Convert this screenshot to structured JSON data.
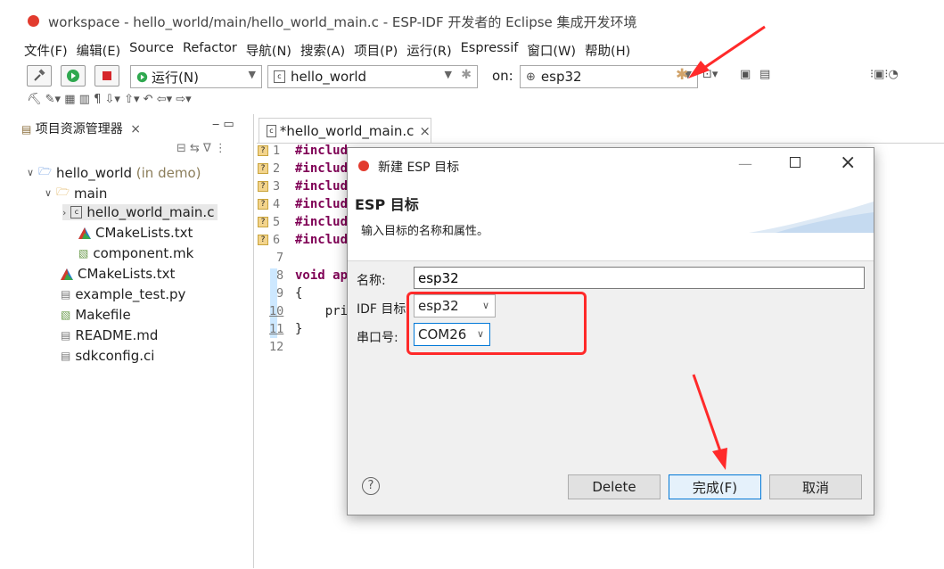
{
  "window": {
    "title": "workspace - hello_world/main/hello_world_main.c - ESP-IDF 开发者的 Eclipse 集成开发环境"
  },
  "menu": [
    "文件(F)",
    "编辑(E)",
    "Source",
    "Refactor",
    "导航(N)",
    "搜索(A)",
    "项目(P)",
    "运行(R)",
    "Espressif",
    "窗口(W)",
    "帮助(H)"
  ],
  "toolbar": {
    "launch_mode": "运行(N)",
    "launch_config": "hello_world",
    "on_label": "on:",
    "target": "esp32"
  },
  "project_explorer": {
    "title": "项目资源管理器",
    "tree": [
      {
        "label": "hello_world",
        "suffix": " (in demo)"
      },
      {
        "label": "main"
      },
      {
        "label": "hello_world_main.c"
      },
      {
        "label": "CMakeLists.txt"
      },
      {
        "label": "component.mk"
      },
      {
        "label": "CMakeLists.txt"
      },
      {
        "label": "example_test.py"
      },
      {
        "label": "Makefile"
      },
      {
        "label": "README.md"
      },
      {
        "label": "sdkconfig.ci"
      }
    ]
  },
  "editor": {
    "tab_title": "*hello_world_main.c",
    "line_numbers": [
      "1",
      "2",
      "3",
      "4",
      "5",
      "6",
      "7",
      "8",
      "9",
      "10",
      "11",
      "12"
    ],
    "lines": [
      "#includ",
      "#includ",
      "#includ",
      "#includ",
      "#includ",
      "#includ",
      "",
      "void ap",
      "{",
      "    pri",
      "}",
      ""
    ]
  },
  "dialog": {
    "title": "新建 ESP 目标",
    "heading": "ESP 目标",
    "description": "输入目标的名称和属性。",
    "name_label": "名称:",
    "name_value": "esp32",
    "idf_label": "IDF 目标",
    "idf_value": "esp32",
    "port_label": "串口号:",
    "port_value": "COM26",
    "delete_button": "Delete",
    "finish_button": "完成(F)",
    "cancel_button": "取消",
    "help_icon": "?"
  },
  "colors": {
    "highlight": "#ff2a2a",
    "keyword": "#7f0055",
    "selection": "#cde8ff"
  }
}
